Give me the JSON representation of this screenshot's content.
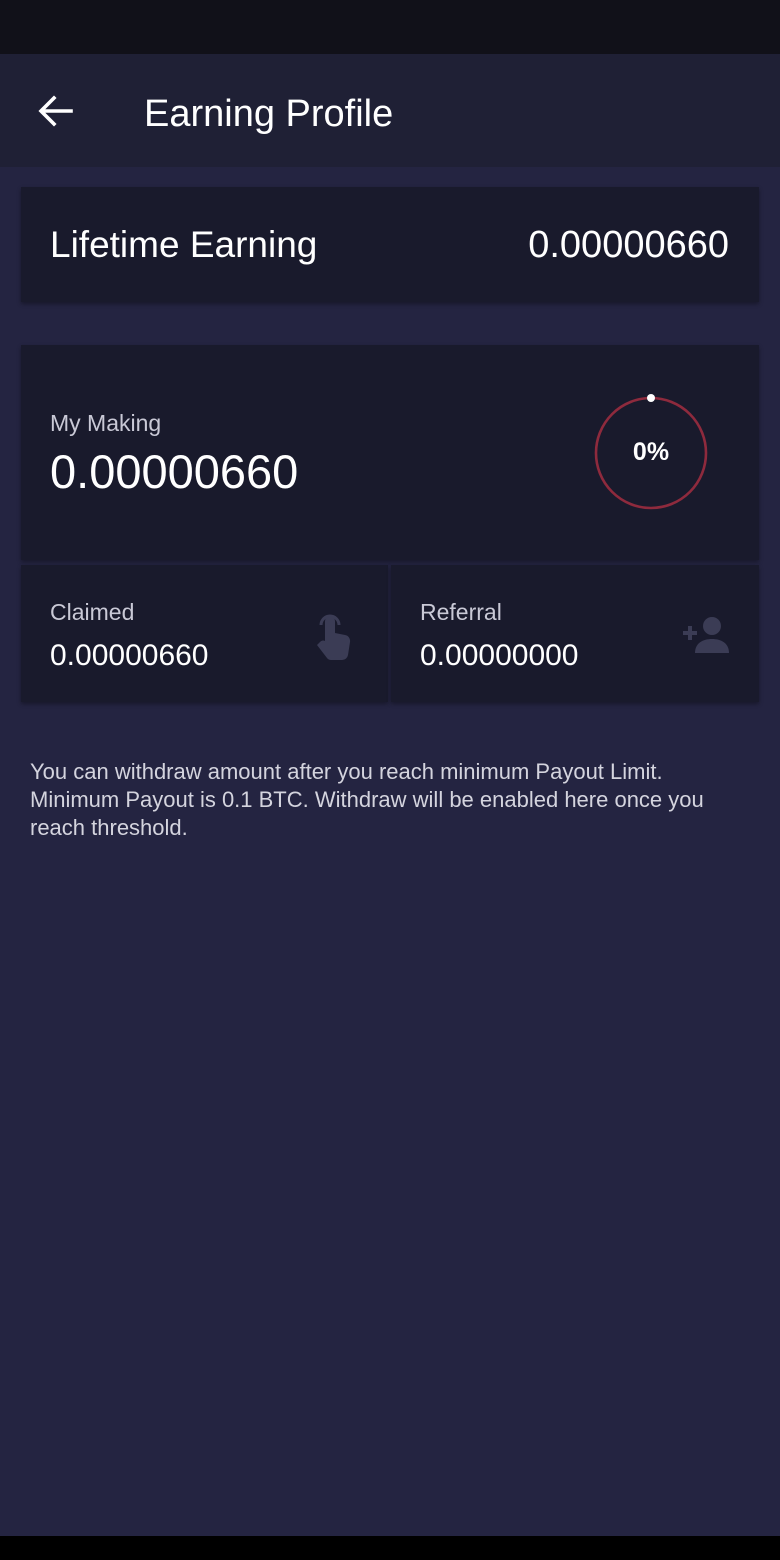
{
  "app_bar": {
    "title": "Earning Profile",
    "back_icon": "arrow-left-icon"
  },
  "lifetime": {
    "label": "Lifetime Earning",
    "value": "0.00000660"
  },
  "making": {
    "label": "My Making",
    "value": "0.00000660",
    "progress_text": "0%",
    "progress_percent": 0,
    "ring_color": "#8e2a3d"
  },
  "claimed": {
    "label": "Claimed",
    "value": "0.00000660",
    "icon": "touch-hand-icon"
  },
  "referral": {
    "label": "Referral",
    "value": "0.00000000",
    "icon": "add-person-icon"
  },
  "info": {
    "text": "You can withdraw amount after you reach minimum Payout Limit. Minimum Payout is 0.1 BTC. Withdraw will be enabled here once you reach threshold."
  }
}
